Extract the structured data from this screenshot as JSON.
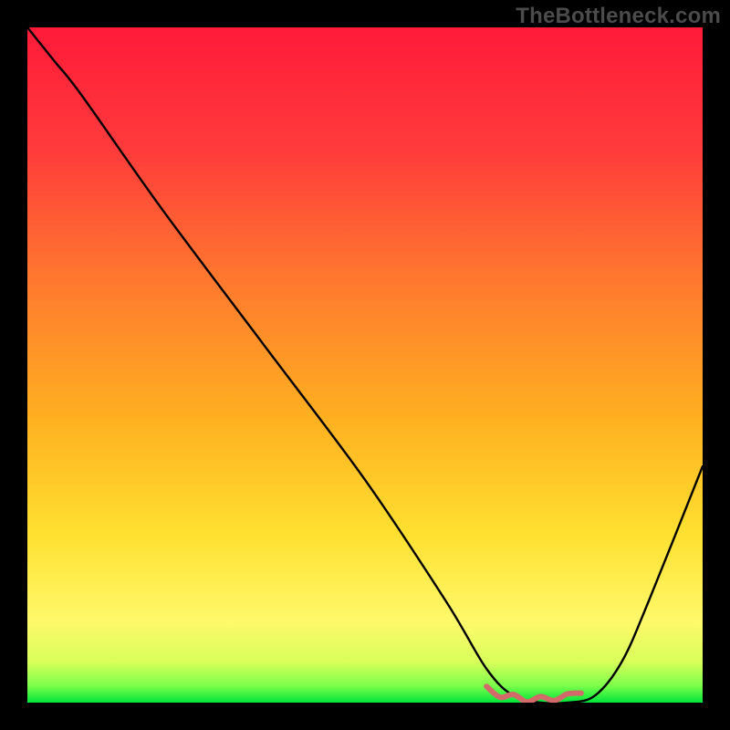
{
  "watermark": "TheBottleneck.com",
  "chart_data": {
    "type": "line",
    "title": "",
    "xlabel": "",
    "ylabel": "",
    "xlim": [
      0,
      100
    ],
    "ylim": [
      0,
      100
    ],
    "notes": "Bottleneck-percentage style curve. No axis ticks or labels are shown. Background is a vertical spectral gradient (red at top through orange/yellow down to green at the very bottom). A black V-shaped curve descends from the top-left to a flat minimum near x≈70–80 and rises toward the right edge. A short pink/red squiggle highlights the flat minimum region.",
    "series": [
      {
        "name": "bottleneck-curve",
        "color": "#000000",
        "x": [
          0,
          4,
          8,
          20,
          35,
          50,
          62,
          68,
          72,
          76,
          80,
          84,
          88,
          92,
          100
        ],
        "values": [
          100,
          95,
          90,
          73,
          53,
          33,
          15,
          5,
          1,
          0,
          0,
          1,
          6,
          15,
          35
        ]
      },
      {
        "name": "highlight-minimum",
        "color": "#d36a6a",
        "x": [
          68,
          70,
          72,
          74,
          76,
          78,
          80,
          82
        ],
        "values": [
          2,
          1.2,
          0.8,
          0.5,
          0.5,
          0.7,
          0.9,
          1.8
        ]
      }
    ],
    "gradient_stops": [
      {
        "offset": 0.0,
        "color": "#ff1a3a"
      },
      {
        "offset": 0.18,
        "color": "#ff3b3b"
      },
      {
        "offset": 0.38,
        "color": "#ff7a2e"
      },
      {
        "offset": 0.58,
        "color": "#ffb020"
      },
      {
        "offset": 0.75,
        "color": "#ffe030"
      },
      {
        "offset": 0.88,
        "color": "#fff96b"
      },
      {
        "offset": 0.94,
        "color": "#d8ff5a"
      },
      {
        "offset": 0.975,
        "color": "#7bff4a"
      },
      {
        "offset": 1.0,
        "color": "#00e53a"
      }
    ]
  }
}
